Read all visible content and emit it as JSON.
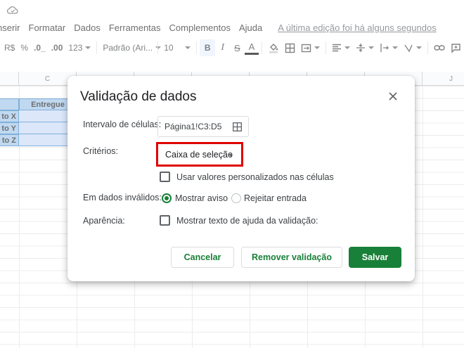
{
  "menu": {
    "items": [
      "nserir",
      "Formatar",
      "Dados",
      "Ferramentas",
      "Complementos",
      "Ajuda"
    ],
    "last_edit": "A última edição foi há alguns segundos"
  },
  "toolbar": {
    "currency": "R$",
    "percent": "%",
    "dec_decrease": ".0_",
    "dec_increase": ".00",
    "number_format": "123",
    "font": "Padrão (Ari...",
    "font_size": "10",
    "bold": "B",
    "italic": "I",
    "strike": "S",
    "text_color": "A"
  },
  "grid": {
    "columns": [
      "C",
      "J"
    ],
    "header_cell": "Entregue",
    "row_labels": [
      "to X",
      "to Y",
      "to Z"
    ]
  },
  "dialog": {
    "title": "Validação de dados",
    "range_label": "Intervalo de células:",
    "range_value": "Página1!C3:D5",
    "criteria_label": "Critérios:",
    "criteria_value": "Caixa de seleção",
    "custom_values_label": "Usar valores personalizados nas células",
    "invalid_label": "Em dados inválidos:",
    "show_warning": "Mostrar aviso",
    "reject_input": "Rejeitar entrada",
    "appearance_label": "Aparência:",
    "help_text_label": "Mostrar texto de ajuda da validação:",
    "cancel": "Cancelar",
    "remove": "Remover validação",
    "save": "Salvar"
  },
  "colors": {
    "accent": "#188038",
    "highlight": "#e00000",
    "header_fill": "#9fc5e8"
  }
}
